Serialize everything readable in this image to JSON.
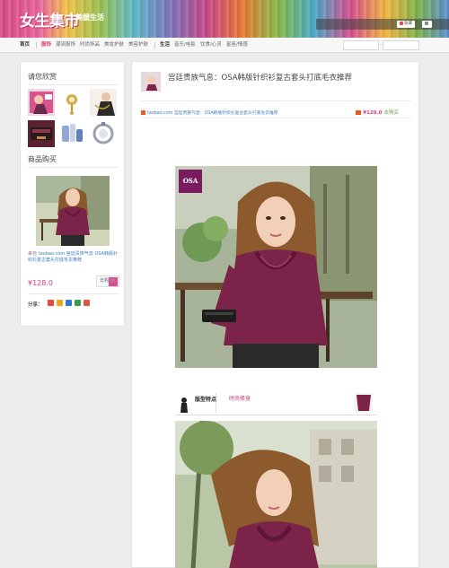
{
  "header": {
    "logo": "女生集市",
    "logo_sub": "美媛生活",
    "domain": "",
    "notice": "",
    "favorite_label": "收藏",
    "contact_label": ""
  },
  "nav": {
    "items": [
      "首页",
      "服饰",
      "潮流服饰",
      "时尚饰品",
      "美妆护肤",
      "美容护肤",
      "生活",
      "音乐/电影",
      "饮食/心灵",
      "星座/情感"
    ],
    "right_buttons": [
      "",
      ""
    ]
  },
  "sidebar": {
    "recommend_title": "请您欣赏",
    "buy_title": "商品购买",
    "source_prefix": "来自",
    "source_site": "taobao.com",
    "source_text": "宫廷贵族气息 OSA韩版针织衫复古套头打底毛衣推荐",
    "price": "¥128.0",
    "buy_label": "去购买",
    "share_label": "分享："
  },
  "article": {
    "title": "宫廷贵族气息：OSA韩版针织衫复古套头打底毛衣推荐",
    "meta": "",
    "source_line": "taobao.com 宫廷贵族气息：OSA韩版针织衫复古套头打底毛衣推荐",
    "price": "¥128.0",
    "go_label": "去购买",
    "intro": "",
    "body": "",
    "brand_logo": "OSA",
    "feature_label": "版型特点",
    "feature_text": "时尚修身",
    "feature_sub": ""
  },
  "colors": {
    "accent_pink": "#e03c7a",
    "link_blue": "#3b7fc4",
    "sweater_burgundy": "#7b2348",
    "brand_purple": "#7a1b62"
  },
  "icons": [
    "favorite-icon",
    "contact-icon",
    "cart-icon",
    "share-sina-icon",
    "share-qzone-icon",
    "share-renren-icon",
    "share-douban-icon",
    "share-kaixin-icon"
  ]
}
